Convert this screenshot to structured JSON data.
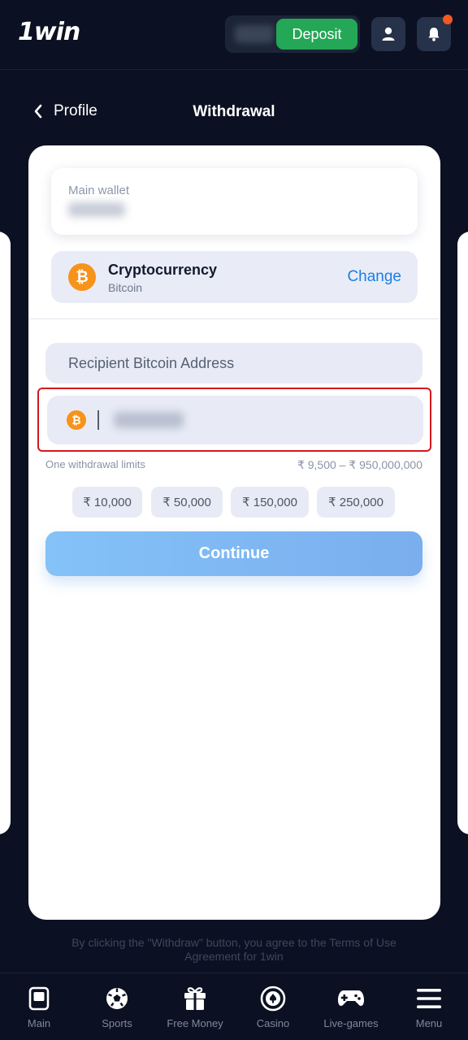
{
  "header": {
    "logo": "1win",
    "deposit_label": "Deposit"
  },
  "title_bar": {
    "back_label": "Profile",
    "title": "Withdrawal"
  },
  "wallet": {
    "label": "Main wallet"
  },
  "method": {
    "name": "Cryptocurrency",
    "sub": "Bitcoin",
    "change_label": "Change",
    "coin_symbol": "₿"
  },
  "form": {
    "address_placeholder": "Recipient Bitcoin Address",
    "limits_label": "One withdrawal limits",
    "limits_value": "₹ 9,500 – ₹ 950,000,000",
    "chips": [
      "₹ 10,000",
      "₹ 50,000",
      "₹ 150,000",
      "₹ 250,000"
    ],
    "continue_label": "Continue"
  },
  "terms": "By clicking the \"Withdraw\" button, you agree to the Terms of Use Agreement for 1win",
  "nav": {
    "items": [
      {
        "label": "Main",
        "icon": "main-icon"
      },
      {
        "label": "Sports",
        "icon": "soccer-ball-icon"
      },
      {
        "label": "Free Money",
        "icon": "gift-icon"
      },
      {
        "label": "Casino",
        "icon": "casino-chip-icon"
      },
      {
        "label": "Live-games",
        "icon": "gamepad-icon"
      },
      {
        "label": "Menu",
        "icon": "hamburger-menu-icon"
      }
    ]
  },
  "colors": {
    "background": "#0b1122",
    "deposit": "#24a756",
    "bitcoin": "#f7931a",
    "link": "#1a7ee6",
    "highlight": "#d3191f"
  }
}
